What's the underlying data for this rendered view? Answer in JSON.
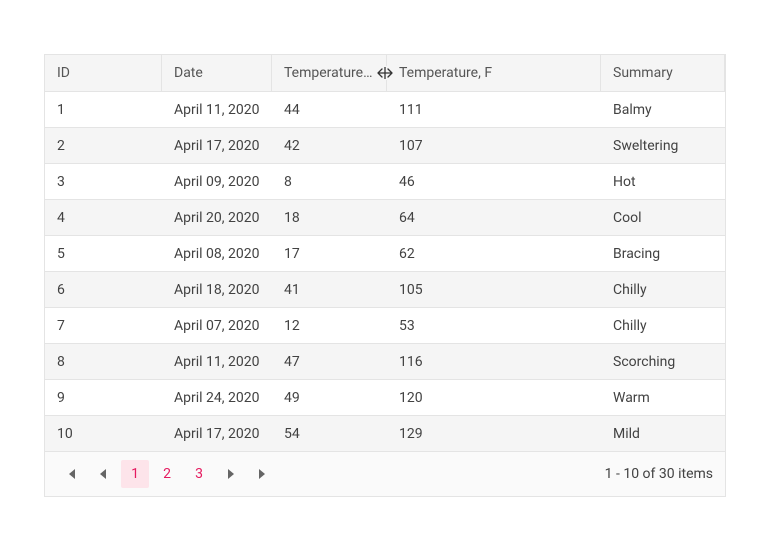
{
  "columns": {
    "id": "ID",
    "date": "Date",
    "tempc": "Temperature, C",
    "tempf": "Temperature, F",
    "summary": "Summary"
  },
  "rows": [
    {
      "id": "1",
      "date": "April 11, 2020",
      "tempc": "44",
      "tempf": "111",
      "summary": "Balmy"
    },
    {
      "id": "2",
      "date": "April 17, 2020",
      "tempc": "42",
      "tempf": "107",
      "summary": "Sweltering"
    },
    {
      "id": "3",
      "date": "April 09, 2020",
      "tempc": "8",
      "tempf": "46",
      "summary": "Hot"
    },
    {
      "id": "4",
      "date": "April 20, 2020",
      "tempc": "18",
      "tempf": "64",
      "summary": "Cool"
    },
    {
      "id": "5",
      "date": "April 08, 2020",
      "tempc": "17",
      "tempf": "62",
      "summary": "Bracing"
    },
    {
      "id": "6",
      "date": "April 18, 2020",
      "tempc": "41",
      "tempf": "105",
      "summary": "Chilly"
    },
    {
      "id": "7",
      "date": "April 07, 2020",
      "tempc": "12",
      "tempf": "53",
      "summary": "Chilly"
    },
    {
      "id": "8",
      "date": "April 11, 2020",
      "tempc": "47",
      "tempf": "116",
      "summary": "Scorching"
    },
    {
      "id": "9",
      "date": "April 24, 2020",
      "tempc": "49",
      "tempf": "120",
      "summary": "Warm"
    },
    {
      "id": "10",
      "date": "April 17, 2020",
      "tempc": "54",
      "tempf": "129",
      "summary": "Mild"
    }
  ],
  "pager": {
    "pages": [
      "1",
      "2",
      "3"
    ],
    "active_page": 0,
    "info": "1 - 10 of 30 items"
  }
}
